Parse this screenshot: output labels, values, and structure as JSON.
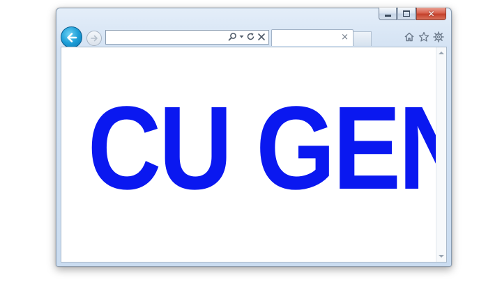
{
  "window": {
    "caption_buttons": {
      "minimize_icon": "minimize-icon",
      "maximize_icon": "restore-icon",
      "close_icon": "close-icon",
      "close_glyph": "✕"
    },
    "nav": {
      "back_icon": "back-arrow-icon",
      "forward_icon": "forward-arrow-icon"
    },
    "address_bar": {
      "value": "",
      "icons": [
        "search-icon",
        "dropdown-icon",
        "refresh-icon",
        "stop-icon"
      ]
    },
    "tab": {
      "title": "",
      "close_glyph": "×"
    },
    "toolbar": {
      "icons": [
        "home-icon",
        "favorites-star-icon",
        "settings-gear-icon"
      ]
    }
  },
  "page": {
    "headline": "CU GEN",
    "headline_color": "#0a18f0"
  },
  "colors": {
    "frame": "#d3e2f3",
    "back_button": "#1e9fd8",
    "close_button": "#c4412c"
  }
}
